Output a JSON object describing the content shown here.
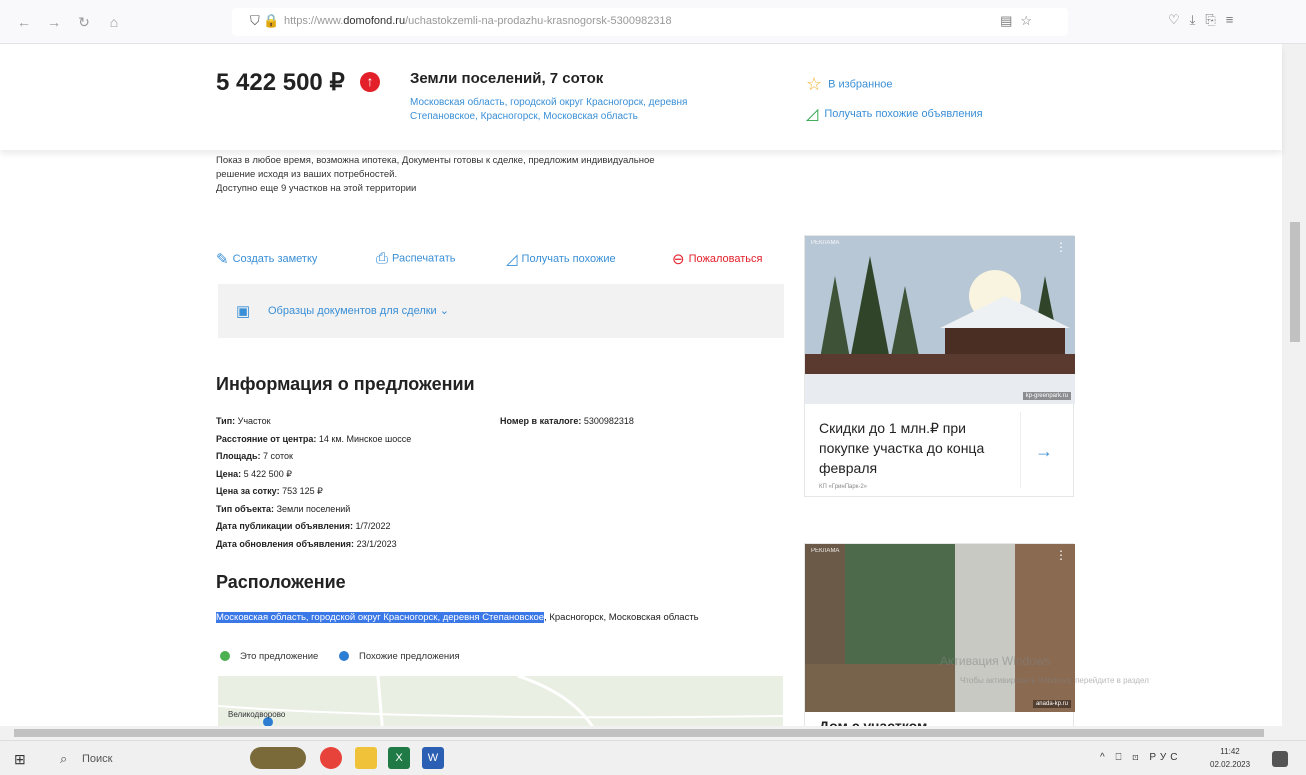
{
  "browser": {
    "url_prefix": "https://www.",
    "url_domain": "domofond.ru",
    "url_path": "/uchastokzemli-na-prodazhu-krasnogorsk-5300982318"
  },
  "header": {
    "price": "5 422 500 ₽",
    "title": "Земли поселений, 7 соток",
    "address": "Московская область, городской округ Красногорск, деревня Степановское, Красногорск, Московская область",
    "favorite": "В избранное",
    "similar": "Получать похожие объявления"
  },
  "description": {
    "line1": "Показ в любое время, возможна ипотека, Документы готовы к сделке, предложим индивидуальное",
    "line2": "решение исходя из ваших потребностей.",
    "line3": "Доступно еще 9 участков на этой территории"
  },
  "actions": {
    "note": "Создать заметку",
    "print": "Распечатать",
    "similar": "Получать похожие",
    "complain": "Пожаловаться"
  },
  "docs": {
    "label": "Образцы документов для сделки"
  },
  "info": {
    "heading": "Информация о предложении",
    "type_label": "Тип:",
    "type_value": "Участок",
    "distance_label": "Расстояние от центра:",
    "distance_value": "14 км. Минское шоссе",
    "area_label": "Площадь:",
    "area_value": "7 соток",
    "price_label": "Цена:",
    "price_value": "5 422 500 ₽",
    "per_sotka_label": "Цена за сотку:",
    "per_sotka_value": "753 125 ₽",
    "object_label": "Тип объекта:",
    "object_value": "Земли поселений",
    "published_label": "Дата публикации объявления:",
    "published_value": "1/7/2022",
    "updated_label": "Дата обновления объявления:",
    "updated_value": "23/1/2023",
    "catalog_label": "Номер в каталоге:",
    "catalog_value": "5300982318"
  },
  "location": {
    "heading": "Расположение",
    "selected": "Московская область, городской округ Красногорск, деревня Степановское",
    "rest": ", Красногорск, Московская область",
    "legend_this": "Это предложение",
    "legend_similar": "Похожие предложения",
    "map_town": "Великодворово"
  },
  "ads": {
    "ad1_tag": "РЕКЛАМА",
    "ad1_src": "kp-greenpark.ru",
    "ad1_title": "Скидки до 1 млн.₽ при покупке участка до конца февраля",
    "ad1_sub": "КП «ГринПарк-2»",
    "ad2_tag": "РЕКЛАМА",
    "ad2_src": "anada-kp.ru",
    "ad2_title": "Дом с участком"
  },
  "watermark": {
    "line1": "Активация Windows",
    "line2": "Чтобы активировать Windows, перейдите в раздел"
  },
  "taskbar": {
    "search_placeholder": "Поиск",
    "lang": "РУС",
    "time": "11:42",
    "date": "02.02.2023"
  },
  "colors": {
    "link": "#3a8fd6",
    "accent_red": "#e3202a",
    "selection": "#3b78e7"
  }
}
